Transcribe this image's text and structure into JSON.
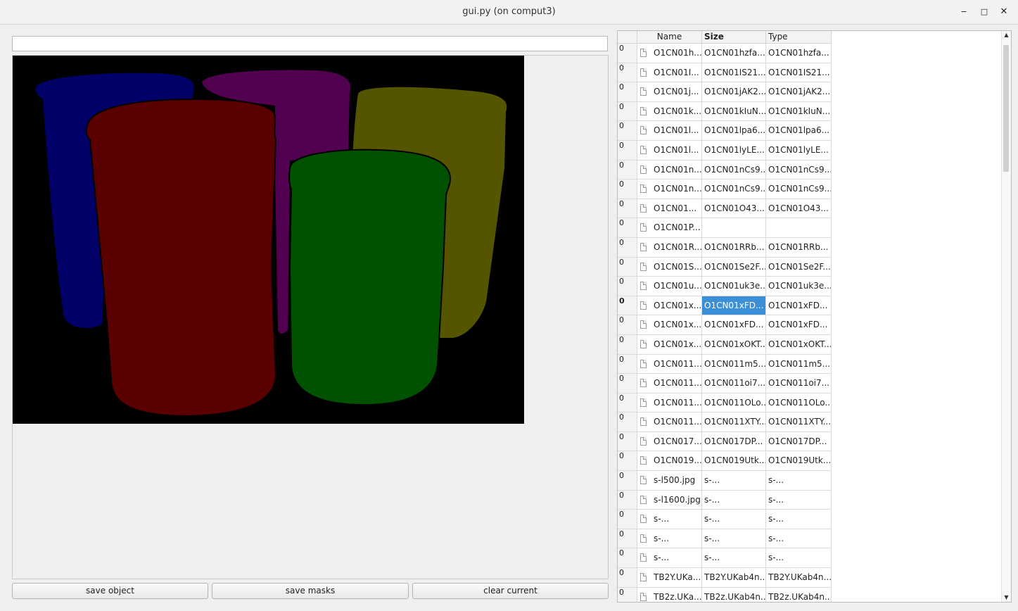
{
  "window": {
    "title": "gui.py (on comput3)",
    "minimize": "‒",
    "maximize": "□",
    "close": "✕"
  },
  "path_input": {
    "value": "",
    "placeholder": ""
  },
  "mask_colors": {
    "background": "#000000",
    "blue": "#000068",
    "purple": "#520050",
    "olive": "#555500",
    "red": "#5a0000",
    "green": "#005200"
  },
  "buttons": {
    "save_object": "save object",
    "save_masks": "save masks",
    "clear_current": "clear current"
  },
  "table": {
    "headers": {
      "name": "Name",
      "size": "Size",
      "type": "Type"
    },
    "selected_color": "#3b8fd6",
    "rows": [
      {
        "idx": "0",
        "name": "O1CN01h...",
        "size": "O1CN01hzfa...",
        "type": "O1CN01hzfa..."
      },
      {
        "idx": "0",
        "name": "O1CN01I...",
        "size": "O1CN01IS21...",
        "type": "O1CN01IS21..."
      },
      {
        "idx": "0",
        "name": "O1CN01j...",
        "size": "O1CN01jAK2...",
        "type": "O1CN01jAK2..."
      },
      {
        "idx": "0",
        "name": "O1CN01k...",
        "size": "O1CN01kIuN...",
        "type": "O1CN01kIuN..."
      },
      {
        "idx": "0",
        "name": "O1CN01l...",
        "size": "O1CN01lpa6...",
        "type": "O1CN01lpa6..."
      },
      {
        "idx": "0",
        "name": "O1CN01l...",
        "size": "O1CN01lyLE...",
        "type": "O1CN01lyLE..."
      },
      {
        "idx": "0",
        "name": "O1CN01n...",
        "size": "O1CN01nCs9...",
        "type": "O1CN01nCs9..."
      },
      {
        "idx": "0",
        "name": "O1CN01n...",
        "size": "O1CN01nCs9...",
        "type": "O1CN01nCs9..."
      },
      {
        "idx": "0",
        "name": "O1CN01...",
        "size": "O1CN01O43...",
        "type": "O1CN01O43..."
      },
      {
        "idx": "0",
        "name": "O1CN01P...",
        "size": "",
        "type": ""
      },
      {
        "idx": "0",
        "name": "O1CN01R...",
        "size": "O1CN01RRb...",
        "type": "O1CN01RRb..."
      },
      {
        "idx": "0",
        "name": "O1CN01S...",
        "size": "O1CN01Se2F...",
        "type": "O1CN01Se2F..."
      },
      {
        "idx": "0",
        "name": "O1CN01u...",
        "size": "O1CN01uk3e...",
        "type": "O1CN01uk3e..."
      },
      {
        "idx": "0",
        "name": "O1CN01x...",
        "size": "O1CN01xFD...",
        "type": "O1CN01xFD...",
        "selected": true
      },
      {
        "idx": "0",
        "name": "O1CN01x...",
        "size": "O1CN01xFD...",
        "type": "O1CN01xFD..."
      },
      {
        "idx": "0",
        "name": "O1CN01x...",
        "size": "O1CN01xOKT...",
        "type": "O1CN01xOKT..."
      },
      {
        "idx": "0",
        "name": "O1CN011...",
        "size": "O1CN011m5...",
        "type": "O1CN011m5..."
      },
      {
        "idx": "0",
        "name": "O1CN011...",
        "size": "O1CN011oi7...",
        "type": "O1CN011oi7..."
      },
      {
        "idx": "0",
        "name": "O1CN011...",
        "size": "O1CN011OLo...",
        "type": "O1CN011OLo..."
      },
      {
        "idx": "0",
        "name": "O1CN011...",
        "size": "O1CN011XTY...",
        "type": "O1CN011XTY..."
      },
      {
        "idx": "0",
        "name": "O1CN017...",
        "size": "O1CN017DP...",
        "type": "O1CN017DP..."
      },
      {
        "idx": "0",
        "name": "O1CN019...",
        "size": "O1CN019Utk...",
        "type": "O1CN019Utk..."
      },
      {
        "idx": "0",
        "name": "s-l500.jpg",
        "size": "s-...",
        "type": "s-..."
      },
      {
        "idx": "0",
        "name": "s-l1600.jpg",
        "size": "s-...",
        "type": "s-..."
      },
      {
        "idx": "0",
        "name": "s-...",
        "size": "s-...",
        "type": "s-..."
      },
      {
        "idx": "0",
        "name": "s-...",
        "size": "s-...",
        "type": "s-..."
      },
      {
        "idx": "0",
        "name": "s-...",
        "size": "s-...",
        "type": "s-..."
      },
      {
        "idx": "0",
        "name": "TB2Y.UKa...",
        "size": "TB2Y.UKab4n...",
        "type": "TB2Y.UKab4n..."
      },
      {
        "idx": "0",
        "name": "TB2z.UKa...",
        "size": "TB2z.UKab4n...",
        "type": "TB2z.UKab4n..."
      }
    ]
  }
}
